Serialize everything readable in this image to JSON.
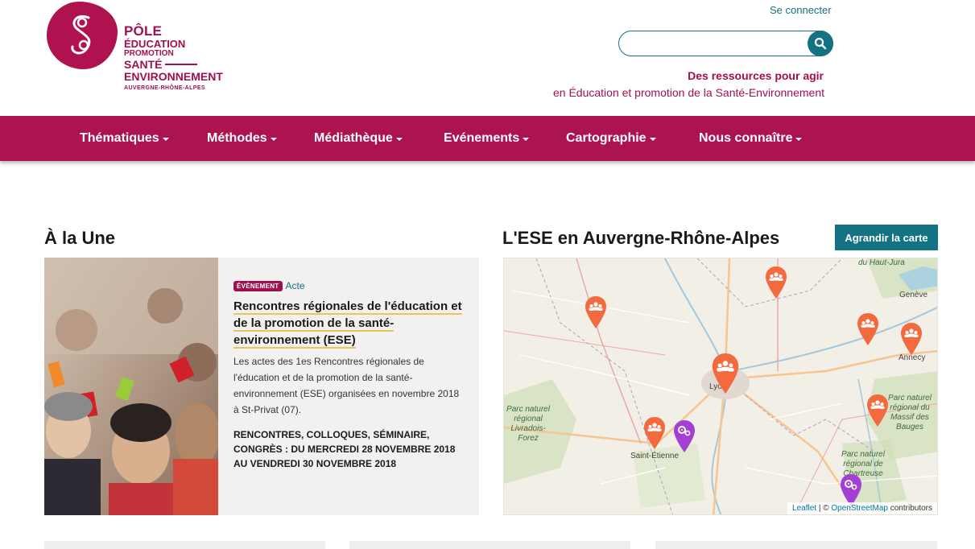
{
  "header": {
    "logo": {
      "line1": "PÔLE",
      "line2": "ÉDUCATION",
      "line3": "PROMOTION",
      "line4": "SANTÉ",
      "line5": "ENVIRONNEMENT",
      "line6": "AUVERGNE-RHÔNE-ALPES"
    },
    "login_label": "Se connecter",
    "search_placeholder": "",
    "tagline_bold": "Des ressources pour agir",
    "tagline": "en Éducation et promotion de la Santé-Environnement"
  },
  "nav": {
    "items": [
      {
        "label": "Thématiques"
      },
      {
        "label": "Méthodes"
      },
      {
        "label": "Médiathèque"
      },
      {
        "label": "Evénements"
      },
      {
        "label": "Cartographie"
      },
      {
        "label": "Nous connaître"
      }
    ]
  },
  "une": {
    "heading": "À la Une",
    "badge": "ÉVÈNEMENT",
    "tag": "Acte",
    "title": "Rencontres régionales de l'éducation et de la promotion de la santé-environnement (ESE)",
    "description": "Les actes des 1es Rencontres régionales de l'éducation et de la promotion de la santé-environnement (ESE) organisées en novembre 2018 à St-Privat (07).",
    "date": "RENCONTRES, COLLOQUES, SÉMINAIRE, CONGRÈS : DU MERCREDI 28 NOVEMBRE 2018 AU VENDREDI 30 NOVEMBRE 2018"
  },
  "ese": {
    "heading": "L'ESE en Auvergne-Rhône-Alpes",
    "enlarge_button": "Agrandir la carte",
    "map": {
      "labels": {
        "lyon": "Lyon",
        "geneve": "Genève",
        "annecy": "Annecy",
        "saint_etienne": "Saint-Étienne",
        "jura": "du Haut-Jura",
        "livradois": "Parc naturel régional Livradois-Forez",
        "bauges": "Parc naturel régional du Massif des Bauges",
        "chartreuse": "Parc naturel régional de Chartreuse"
      },
      "attribution": {
        "leaflet": "Leaflet",
        "sep": "| ©",
        "osm": "OpenStreetMap",
        "contributors": "contributors"
      }
    },
    "colors": {
      "pin_orange": "#f26a3d",
      "pin_purple": "#a43fd6",
      "brand": "#ac1451",
      "teal": "#137383"
    }
  }
}
